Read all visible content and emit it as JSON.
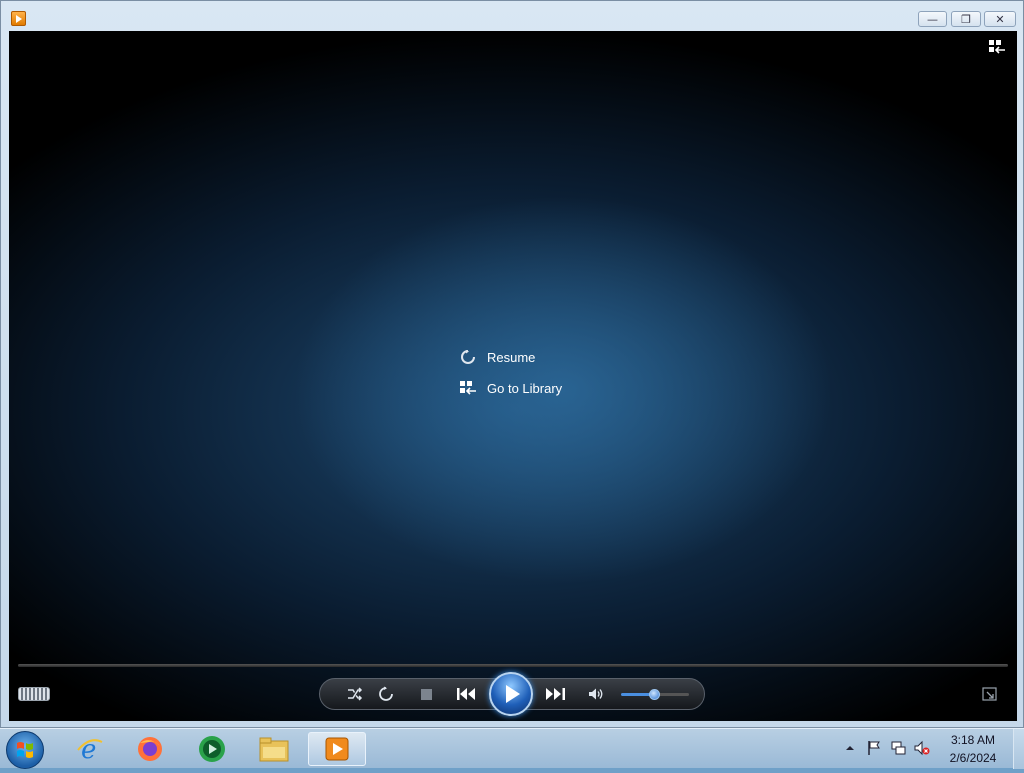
{
  "window": {
    "minimize_label": "—",
    "restore_label": "❐",
    "close_label": "✕"
  },
  "overlay_menu": {
    "resume_label": "Resume",
    "library_label": "Go to Library"
  },
  "player": {
    "seek_progress": 0,
    "volume_level": 0.5
  },
  "taskbar": {
    "apps": [
      "start-button",
      "internet-explorer",
      "firefox",
      "media-center",
      "file-explorer",
      "windows-media-player"
    ],
    "clock_time": "3:18 AM",
    "clock_date": "2/6/2024"
  },
  "colors": {
    "accent_blue": "#2d74d0",
    "video_glow": "#1e4a72"
  }
}
